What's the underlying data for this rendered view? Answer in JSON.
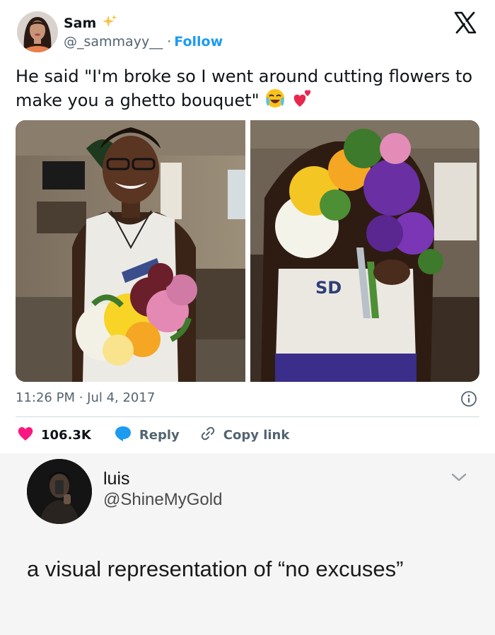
{
  "tweet": {
    "author": {
      "name": "Sam",
      "handle": "@_sammayy__",
      "separator": "·",
      "follow_label": "Follow",
      "name_emoji_icon": "sparkles-icon"
    },
    "logo_icon": "x-logo-icon",
    "text": "He said \"I'm broke so I went around cutting flowers to make you a ghetto bouquet\"",
    "text_emojis": [
      "crying-laughing-emoji",
      "two-hearts-emoji"
    ],
    "photos": [
      "man-holding-bouquet-smiling",
      "bouquet-closeup"
    ],
    "timestamp": "11:26 PM · Jul 4, 2017",
    "actions": {
      "likes_count": "106.3K",
      "reply_label": "Reply",
      "copy_link_label": "Copy link"
    },
    "colors": {
      "accent": "#1d9bf0",
      "like": "#f91880",
      "muted": "#536471",
      "text": "#0f1419"
    }
  },
  "reply": {
    "name": "luis",
    "handle": "@ShineMyGold",
    "text": "a visual representation of “no excuses”",
    "background": "#f5f5f5"
  }
}
